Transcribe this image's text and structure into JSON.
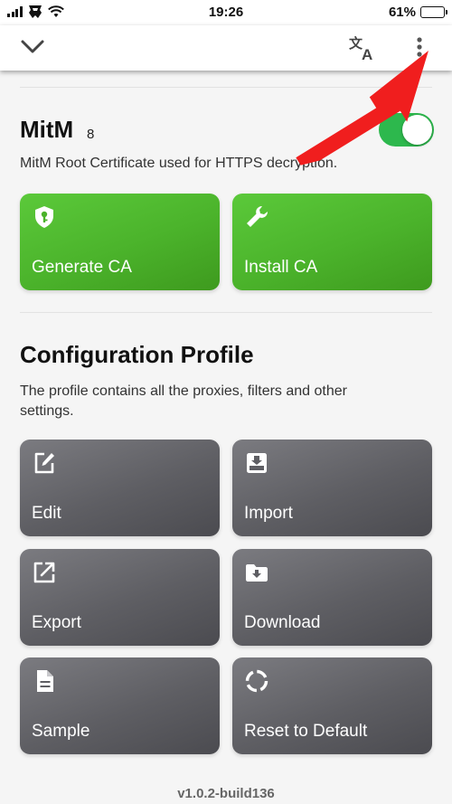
{
  "status_bar": {
    "time": "19:26",
    "battery": "61%",
    "battery_level": 0.61
  },
  "nav": {
    "chevron_icon": "chevron-down-icon",
    "translate_icon": "translate-icon",
    "more_icon": "more-vertical-icon"
  },
  "mitm": {
    "title": "MitM",
    "count": "8",
    "enabled": true,
    "description": "MitM Root Certificate used for HTTPS decryption.",
    "buttons": [
      {
        "label": "Generate CA",
        "icon": "shield-key-icon"
      },
      {
        "label": "Install CA",
        "icon": "wrench-icon"
      }
    ]
  },
  "config": {
    "title": "Configuration Profile",
    "description": "The profile contains all the proxies, filters and other settings.",
    "buttons": [
      {
        "label": "Edit",
        "icon": "edit-icon"
      },
      {
        "label": "Import",
        "icon": "import-icon"
      },
      {
        "label": "Export",
        "icon": "export-icon"
      },
      {
        "label": "Download",
        "icon": "download-folder-icon"
      },
      {
        "label": "Sample",
        "icon": "document-icon"
      },
      {
        "label": "Reset to Default",
        "icon": "reset-icon"
      }
    ]
  },
  "version": "v1.0.2-build136",
  "colors": {
    "accent_green": "#4bb32b",
    "toggle_green": "#2db84d",
    "card_gray": "#5e5e63",
    "arrow_red": "#f01e1e"
  }
}
